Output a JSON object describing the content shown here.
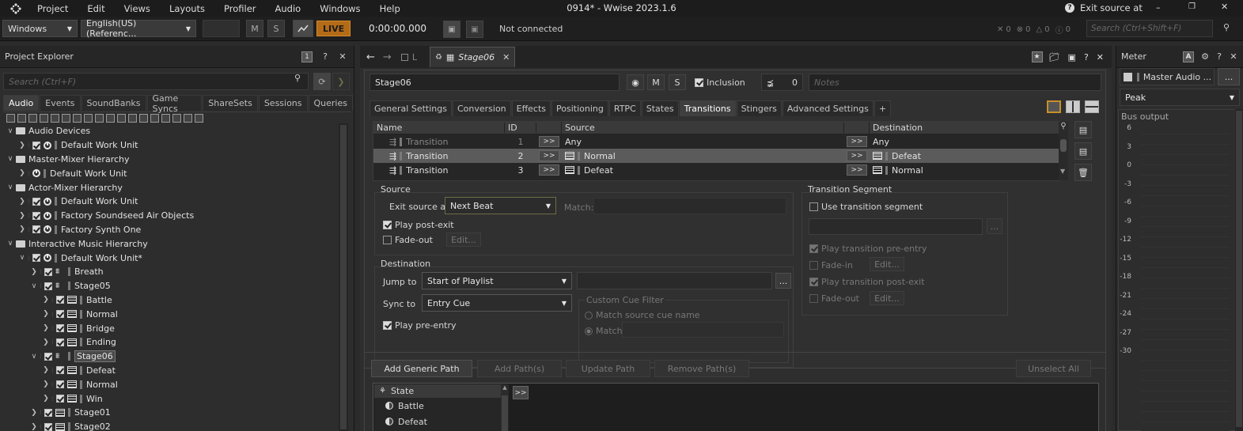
{
  "menu": [
    "Project",
    "Edit",
    "Views",
    "Layouts",
    "Profiler",
    "Audio",
    "Windows",
    "Help"
  ],
  "window_title": "0914* - Wwise 2023.1.6",
  "exit_source_help": "Exit source at",
  "toolbar": {
    "platform": "Windows",
    "language": "English(US) (Referenc...",
    "m_label": "M",
    "s_label": "S",
    "live_label": "LIVE",
    "time": "0:00:00.000",
    "connection": "Not connected",
    "counts": [
      "0",
      "0",
      "0",
      "0"
    ],
    "search_placeholder": "Search (Ctrl+Shift+F)"
  },
  "project_explorer": {
    "title": "Project Explorer",
    "badge": "1",
    "search_placeholder": "Search (Ctrl+F)",
    "tabs": [
      "Audio",
      "Events",
      "SoundBanks",
      "Game Syncs",
      "ShareSets",
      "Sessions",
      "Queries"
    ],
    "active_tab": "Audio",
    "tree": [
      {
        "label": "Audio Devices",
        "depth": 0,
        "chev": "v",
        "icon": "folder",
        "check": false
      },
      {
        "label": "Default Work Unit",
        "depth": 1,
        "chev": ">",
        "icon": "wu",
        "check": true
      },
      {
        "label": "Master-Mixer Hierarchy",
        "depth": 0,
        "chev": "v",
        "icon": "folder",
        "check": false
      },
      {
        "label": "Default Work Unit",
        "depth": 1,
        "chev": ">",
        "icon": "wu",
        "check": false
      },
      {
        "label": "Actor-Mixer Hierarchy",
        "depth": 0,
        "chev": "v",
        "icon": "folder",
        "check": false
      },
      {
        "label": "Default Work Unit",
        "depth": 1,
        "chev": ">",
        "icon": "wu",
        "check": true
      },
      {
        "label": "Factory Soundseed Air Objects",
        "depth": 1,
        "chev": ">",
        "icon": "wu",
        "check": true
      },
      {
        "label": "Factory Synth One",
        "depth": 1,
        "chev": ">",
        "icon": "wu",
        "check": true
      },
      {
        "label": "Interactive Music Hierarchy",
        "depth": 0,
        "chev": "v",
        "icon": "folder",
        "check": false
      },
      {
        "label": "Default Work Unit*",
        "depth": 1,
        "chev": "v",
        "icon": "wu",
        "check": true
      },
      {
        "label": "Breath",
        "depth": 2,
        "chev": ">",
        "icon": "switch",
        "check": true
      },
      {
        "label": "Stage05",
        "depth": 2,
        "chev": "v",
        "icon": "switch",
        "check": true
      },
      {
        "label": "Battle",
        "depth": 3,
        "chev": ">",
        "icon": "seg",
        "check": true
      },
      {
        "label": "Normal",
        "depth": 3,
        "chev": ">",
        "icon": "seg",
        "check": true
      },
      {
        "label": "Bridge",
        "depth": 3,
        "chev": ">",
        "icon": "seg",
        "check": true
      },
      {
        "label": "Ending",
        "depth": 3,
        "chev": ">",
        "icon": "seg",
        "check": true
      },
      {
        "label": "Stage06",
        "depth": 2,
        "chev": "v",
        "icon": "switch",
        "check": true,
        "selected": true
      },
      {
        "label": "Defeat",
        "depth": 3,
        "chev": ">",
        "icon": "seg",
        "check": true
      },
      {
        "label": "Normal",
        "depth": 3,
        "chev": ">",
        "icon": "seg",
        "check": true
      },
      {
        "label": "Win",
        "depth": 3,
        "chev": ">",
        "icon": "seg",
        "check": true
      },
      {
        "label": "Stage01",
        "depth": 2,
        "chev": ">",
        "icon": "seg",
        "check": true
      },
      {
        "label": "Stage02",
        "depth": 2,
        "chev": ">",
        "icon": "seg",
        "check": true
      }
    ]
  },
  "editor": {
    "nav_tab_label": "L",
    "doc_tab": "Stage06",
    "name_value": "Stage06",
    "m_label": "M",
    "s_label": "S",
    "inclusion_label": "Inclusion",
    "share_count": "0",
    "notes_placeholder": "Notes",
    "prop_tabs": [
      "General Settings",
      "Conversion",
      "Effects",
      "Positioning",
      "RTPC",
      "States",
      "Transitions",
      "Stingers",
      "Advanced Settings",
      "+"
    ],
    "active_prop_tab": "Transitions",
    "grid_headers": {
      "name": "Name",
      "id": "ID",
      "source": "Source",
      "destination": "Destination"
    },
    "transitions": [
      {
        "name": "Transition",
        "id": "1",
        "source": "Any",
        "destination": "Any",
        "dim": true
      },
      {
        "name": "Transition",
        "id": "2",
        "source": "Normal",
        "destination": "Defeat",
        "selected": true
      },
      {
        "name": "Transition",
        "id": "3",
        "source": "Defeat",
        "destination": "Normal"
      }
    ],
    "arrow_label": ">>",
    "source_section": {
      "title": "Source",
      "exit_label": "Exit source at",
      "exit_value": "Next Beat",
      "match_label": "Match:",
      "play_post_exit": "Play post-exit",
      "fade_out": "Fade-out",
      "edit": "Edit..."
    },
    "destination_section": {
      "title": "Destination",
      "jump_label": "Jump to",
      "jump_value": "Start of Playlist",
      "sync_label": "Sync to",
      "sync_value": "Entry Cue",
      "play_pre_entry": "Play pre-entry",
      "ellipsis": "...",
      "cue_filter_title": "Custom Cue Filter",
      "match_source_cue": "Match source cue name",
      "match": "Match:"
    },
    "transition_segment": {
      "title": "Transition Segment",
      "use_segment": "Use transition segment",
      "ellipsis": "...",
      "play_pre_entry": "Play transition pre-entry",
      "fade_in": "Fade-in",
      "play_post_exit": "Play transition post-exit",
      "fade_out": "Fade-out",
      "edit": "Edit..."
    },
    "path_buttons": [
      "Add Generic Path",
      "Add Path(s)",
      "Update Path",
      "Remove Path(s)"
    ],
    "unselect_all": "Unselect All",
    "state_list": {
      "header": "State",
      "items": [
        "Battle",
        "Defeat"
      ]
    }
  },
  "meter": {
    "title": "Meter",
    "bus": "Master Audio ...",
    "more": "...",
    "mode": "Peak",
    "bus_output": "Bus output",
    "ticks": [
      "6",
      "3",
      "0",
      "-3",
      "-6",
      "-9",
      "-12",
      "-15",
      "-18",
      "-21",
      "-24",
      "-27",
      "-30"
    ]
  }
}
